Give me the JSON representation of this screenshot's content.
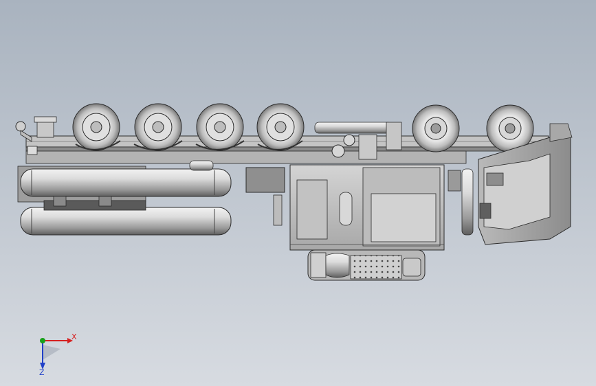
{
  "viewport": {
    "background_top": "#a9b3bf",
    "background_bottom": "#d7dbe1"
  },
  "triad": {
    "x_label": "X",
    "z_label": "Z",
    "x_color": "#d62020",
    "z_color": "#2040c8",
    "y_color": "#18a018"
  },
  "model": {
    "part_fill": "#c8c8c8",
    "part_shadow": "#6e6e6e",
    "edge_color": "#2a2a2a",
    "wheel_fill": "#d0d0d0"
  }
}
